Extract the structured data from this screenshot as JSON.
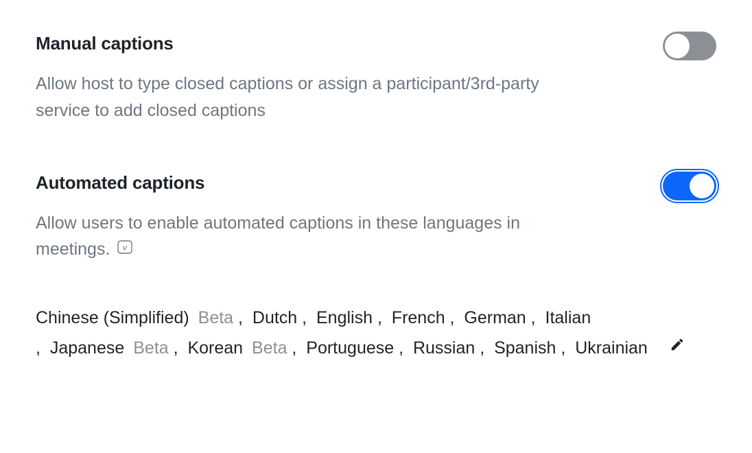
{
  "manual": {
    "title": "Manual captions",
    "description": "Allow host to type closed captions or assign a participant/3rd-party service to add closed captions",
    "enabled": false
  },
  "automated": {
    "title": "Automated captions",
    "description": "Allow users to enable automated captions in these languages in meetings.",
    "enabled": true,
    "info_icon": "v-badge-icon",
    "beta_label": "Beta",
    "languages": [
      {
        "name": "Chinese (Simplified)",
        "beta": true
      },
      {
        "name": "Dutch",
        "beta": false
      },
      {
        "name": "English",
        "beta": false
      },
      {
        "name": "French",
        "beta": false
      },
      {
        "name": "German",
        "beta": false
      },
      {
        "name": "Italian",
        "beta": false
      },
      {
        "name": "Japanese",
        "beta": true
      },
      {
        "name": "Korean",
        "beta": true
      },
      {
        "name": "Portuguese",
        "beta": false
      },
      {
        "name": "Russian",
        "beta": false
      },
      {
        "name": "Spanish",
        "beta": false
      },
      {
        "name": "Ukrainian",
        "beta": false
      }
    ],
    "edit_icon": "pencil-icon"
  }
}
